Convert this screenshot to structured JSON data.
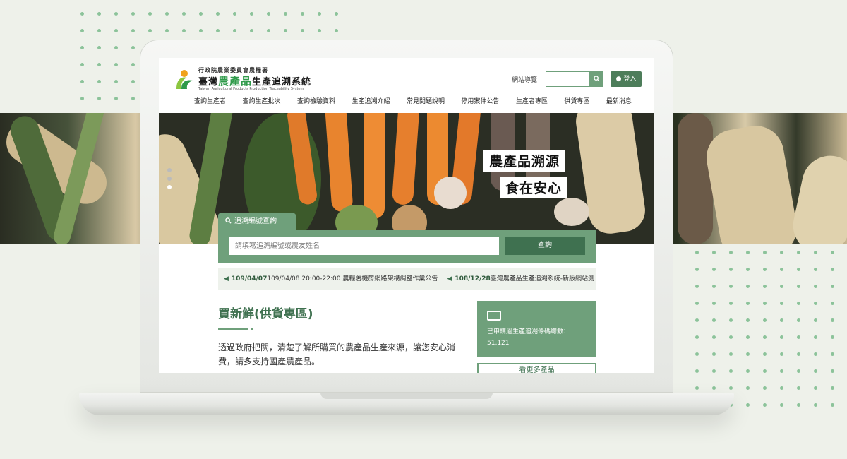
{
  "header": {
    "org": "行政院農業委員會農糧署",
    "title_prefix": "臺灣",
    "title_highlight": "農產品",
    "title_suffix": "生產追溯系統",
    "subtitle": "Taiwan Agricultural Products Production Traceability System",
    "sitemap": "網站導覽",
    "search_icon": "search-icon",
    "login_label": "登入"
  },
  "nav": {
    "items": [
      "查詢生產者",
      "查詢生產批次",
      "查詢檢驗資料",
      "生產追溯介紹",
      "常見問題說明",
      "停用案件公告",
      "生產者專區",
      "供貨專區",
      "最新消息"
    ]
  },
  "hero": {
    "line1": "農產品溯源",
    "line2": "食在安心"
  },
  "search": {
    "tab_label": "追溯編號查詢",
    "placeholder": "請填寫追溯編號或農友姓名",
    "button_label": "查詢"
  },
  "ticker": {
    "items": [
      {
        "date": "109/04/07",
        "text": "109/04/08 20:00-22:00 農糧署機房網路架構調整作業公告"
      },
      {
        "date": "108/12/28",
        "text": "臺灣農產品生產追溯系統-新版網站測"
      }
    ]
  },
  "content": {
    "title": "買新鮮(供貨專區)",
    "description": "透過政府把關，清楚了解所購買的農產品生產來源，讓您安心消費，請多支持國產農產品。",
    "stats_label": "已申購過生產追溯條碼總數：51,121",
    "more_label": "看更多產品"
  },
  "colors": {
    "primary_green": "#6fa07b",
    "dark_green": "#3f7150",
    "text_green": "#2f9a4a"
  }
}
